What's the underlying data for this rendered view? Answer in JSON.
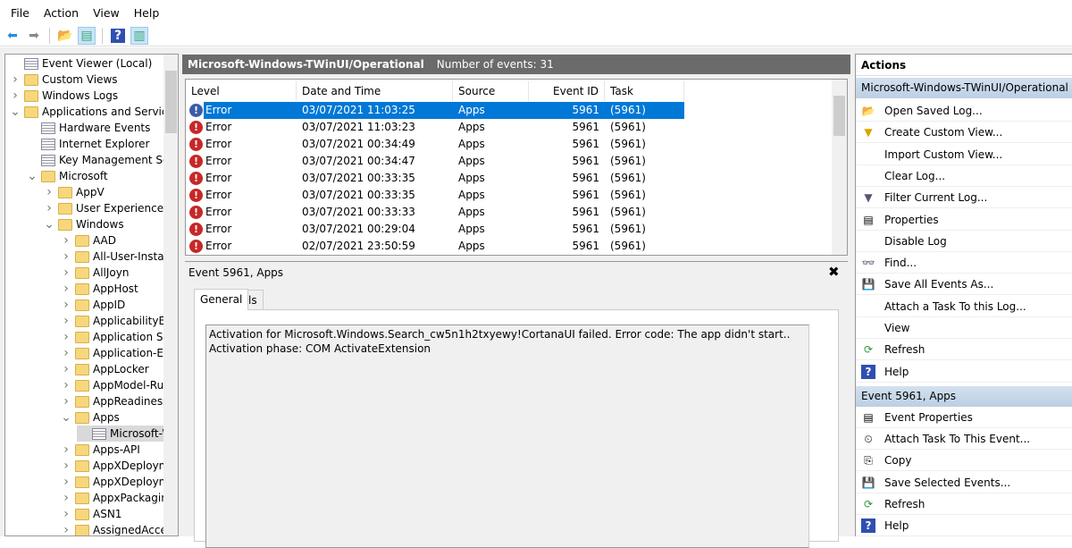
{
  "menu": [
    "File",
    "Action",
    "View",
    "Help"
  ],
  "toolbar": [
    {
      "icon": "back-arrow-icon",
      "glyph": "⬅",
      "color": "#2b8fd6"
    },
    {
      "icon": "forward-arrow-icon",
      "glyph": "➡",
      "color": "#888"
    },
    {
      "icon": "up-folder-icon",
      "glyph": "📂",
      "color": "#d9a400"
    },
    {
      "icon": "show-hide-tree-icon",
      "glyph": "▤",
      "color": "#3a7"
    },
    {
      "icon": "help-icon",
      "glyph": "?",
      "color": "#fff"
    },
    {
      "icon": "show-hide-action-pane-icon",
      "glyph": "▥",
      "color": "#3a7"
    }
  ],
  "tree": [
    {
      "label": "Event Viewer (Local)",
      "depth": 0,
      "arrow": "",
      "icon": "log"
    },
    {
      "label": "Custom Views",
      "depth": 0,
      "arrow": ">",
      "icon": "folder"
    },
    {
      "label": "Windows Logs",
      "depth": 0,
      "arrow": ">",
      "icon": "folder"
    },
    {
      "label": "Applications and Services Logs",
      "depth": 0,
      "arrow": "v",
      "icon": "folder"
    },
    {
      "label": "Hardware Events",
      "depth": 1,
      "arrow": "",
      "icon": "log"
    },
    {
      "label": "Internet Explorer",
      "depth": 1,
      "arrow": "",
      "icon": "log"
    },
    {
      "label": "Key Management Service",
      "depth": 1,
      "arrow": "",
      "icon": "log"
    },
    {
      "label": "Microsoft",
      "depth": 1,
      "arrow": "v",
      "icon": "folder"
    },
    {
      "label": "AppV",
      "depth": 2,
      "arrow": ">",
      "icon": "folder"
    },
    {
      "label": "User Experience Virtualization",
      "depth": 2,
      "arrow": ">",
      "icon": "folder"
    },
    {
      "label": "Windows",
      "depth": 2,
      "arrow": "v",
      "icon": "folder"
    },
    {
      "label": "AAD",
      "depth": 3,
      "arrow": ">",
      "icon": "folder"
    },
    {
      "label": "All-User-Install-Agent",
      "depth": 3,
      "arrow": ">",
      "icon": "folder"
    },
    {
      "label": "AllJoyn",
      "depth": 3,
      "arrow": ">",
      "icon": "folder"
    },
    {
      "label": "AppHost",
      "depth": 3,
      "arrow": ">",
      "icon": "folder"
    },
    {
      "label": "AppID",
      "depth": 3,
      "arrow": ">",
      "icon": "folder"
    },
    {
      "label": "ApplicabilityEngine",
      "depth": 3,
      "arrow": ">",
      "icon": "folder"
    },
    {
      "label": "Application Server-Applications",
      "depth": 3,
      "arrow": ">",
      "icon": "folder"
    },
    {
      "label": "Application-Experience",
      "depth": 3,
      "arrow": ">",
      "icon": "folder"
    },
    {
      "label": "AppLocker",
      "depth": 3,
      "arrow": ">",
      "icon": "folder"
    },
    {
      "label": "AppModel-Runtime",
      "depth": 3,
      "arrow": ">",
      "icon": "folder"
    },
    {
      "label": "AppReadiness",
      "depth": 3,
      "arrow": ">",
      "icon": "folder"
    },
    {
      "label": "Apps",
      "depth": 3,
      "arrow": "v",
      "icon": "folder"
    },
    {
      "label": "Microsoft-Windows-TWinUI/Operational",
      "depth": 4,
      "arrow": "",
      "icon": "log",
      "selected": true
    },
    {
      "label": "Apps-API",
      "depth": 3,
      "arrow": ">",
      "icon": "folder"
    },
    {
      "label": "AppXDeployment",
      "depth": 3,
      "arrow": ">",
      "icon": "folder"
    },
    {
      "label": "AppXDeployment-Server",
      "depth": 3,
      "arrow": ">",
      "icon": "folder"
    },
    {
      "label": "AppxPackagingOM",
      "depth": 3,
      "arrow": ">",
      "icon": "folder"
    },
    {
      "label": "ASN1",
      "depth": 3,
      "arrow": ">",
      "icon": "folder"
    },
    {
      "label": "AssignedAccess",
      "depth": 3,
      "arrow": ">",
      "icon": "folder"
    }
  ],
  "log": {
    "name": "Microsoft-Windows-TWinUI/Operational",
    "count_text": "Number of events: 31"
  },
  "columns": [
    "Level",
    "Date and Time",
    "Source",
    "Event ID",
    "Task Category"
  ],
  "events": [
    {
      "level": "Error",
      "date": "03/07/2021 11:03:25",
      "source": "Apps",
      "id": "5961",
      "task": "(5961)",
      "selected": true
    },
    {
      "level": "Error",
      "date": "03/07/2021 11:03:23",
      "source": "Apps",
      "id": "5961",
      "task": "(5961)"
    },
    {
      "level": "Error",
      "date": "03/07/2021 00:34:49",
      "source": "Apps",
      "id": "5961",
      "task": "(5961)"
    },
    {
      "level": "Error",
      "date": "03/07/2021 00:34:47",
      "source": "Apps",
      "id": "5961",
      "task": "(5961)"
    },
    {
      "level": "Error",
      "date": "03/07/2021 00:33:35",
      "source": "Apps",
      "id": "5961",
      "task": "(5961)"
    },
    {
      "level": "Error",
      "date": "03/07/2021 00:33:35",
      "source": "Apps",
      "id": "5961",
      "task": "(5961)"
    },
    {
      "level": "Error",
      "date": "03/07/2021 00:33:33",
      "source": "Apps",
      "id": "5961",
      "task": "(5961)"
    },
    {
      "level": "Error",
      "date": "03/07/2021 00:29:04",
      "source": "Apps",
      "id": "5961",
      "task": "(5961)"
    },
    {
      "level": "Error",
      "date": "02/07/2021 23:50:59",
      "source": "Apps",
      "id": "5961",
      "task": "(5961)"
    }
  ],
  "detail": {
    "title": "Event 5961, Apps",
    "close": "✖",
    "tabs": [
      "General",
      "Details"
    ],
    "description": "Activation for Microsoft.Windows.Search_cw5n1h2txyewy!CortanaUI failed. Error code: The app didn't start.. Activation phase: COM ActivateExtension"
  },
  "actions": {
    "header": "Actions",
    "sections": [
      {
        "title": "Microsoft-Windows-TWinUI/Operational",
        "items": [
          {
            "label": "Open Saved Log...",
            "icon": "open-folder-icon",
            "glyph": "📂"
          },
          {
            "label": "Create Custom View...",
            "icon": "filter-icon",
            "glyph": "▼"
          },
          {
            "label": "Import Custom View...",
            "icon": "",
            "glyph": ""
          },
          {
            "label": "Clear Log...",
            "icon": "",
            "glyph": ""
          },
          {
            "label": "Filter Current Log...",
            "icon": "filter-icon",
            "glyph": "▼"
          },
          {
            "label": "Properties",
            "icon": "properties-icon",
            "glyph": "▤"
          },
          {
            "label": "Disable Log",
            "icon": "",
            "glyph": ""
          },
          {
            "label": "Find...",
            "icon": "binoculars-icon",
            "glyph": "👓"
          },
          {
            "label": "Save All Events As...",
            "icon": "save-icon",
            "glyph": "💾"
          },
          {
            "label": "Attach a Task To this Log...",
            "icon": "",
            "glyph": ""
          },
          {
            "label": "View",
            "icon": "",
            "glyph": ""
          },
          {
            "label": "Refresh",
            "icon": "refresh-icon",
            "glyph": "⟳"
          },
          {
            "label": "Help",
            "icon": "help-icon",
            "glyph": "?"
          }
        ]
      },
      {
        "title": "Event 5961, Apps",
        "items": [
          {
            "label": "Event Properties",
            "icon": "properties-icon",
            "glyph": "▤"
          },
          {
            "label": "Attach Task To This Event...",
            "icon": "task-clock-icon",
            "glyph": "⏲"
          },
          {
            "label": "Copy",
            "icon": "copy-icon",
            "glyph": "⎘"
          },
          {
            "label": "Save Selected Events...",
            "icon": "save-icon",
            "glyph": "💾"
          },
          {
            "label": "Refresh",
            "icon": "refresh-icon",
            "glyph": "⟳"
          },
          {
            "label": "Help",
            "icon": "help-icon",
            "glyph": "?"
          }
        ]
      }
    ]
  }
}
